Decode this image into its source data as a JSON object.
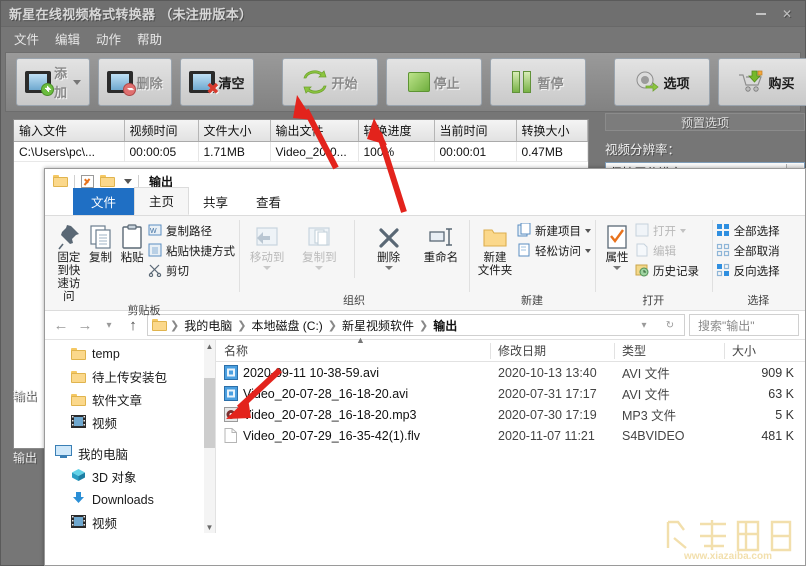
{
  "converter": {
    "title": "新星在线视频格式转换器 （未注册版本）",
    "window_buttons": [
      "minimize",
      "close"
    ],
    "menu": [
      "文件",
      "编辑",
      "动作",
      "帮助"
    ],
    "toolbar": [
      {
        "label": "添加",
        "icon": "film-add-icon",
        "has_dropdown": true,
        "disabled": true
      },
      {
        "label": "删除",
        "icon": "film-remove-icon",
        "has_dropdown": false,
        "disabled": true
      },
      {
        "label": "清空",
        "icon": "film-clear-icon",
        "has_dropdown": false,
        "disabled": false
      },
      {
        "label": "开始",
        "icon": "refresh-icon",
        "has_dropdown": false,
        "disabled": true
      },
      {
        "label": "停止",
        "icon": "stop-icon",
        "has_dropdown": false,
        "disabled": true
      },
      {
        "label": "暂停",
        "icon": "pause-icon",
        "has_dropdown": false,
        "disabled": true
      },
      {
        "label": "选项",
        "icon": "gear-icon",
        "has_dropdown": false,
        "disabled": false
      },
      {
        "label": "购买",
        "icon": "cart-icon",
        "has_dropdown": false,
        "disabled": false
      }
    ],
    "list": {
      "columns": [
        "输入文件",
        "视频时间",
        "文件大小",
        "输出文件",
        "转换进度",
        "当前时间",
        "转换大小"
      ],
      "rows": [
        {
          "input": "C:\\Users\\pc\\...",
          "duration": "00:00:05",
          "filesize": "1.71MB",
          "output": "Video_20-0...",
          "progress": "100%",
          "current_time": "00:00:01",
          "converted_size": "0.47MB"
        }
      ]
    },
    "right_panel": {
      "header": "预置选项",
      "resolution_label": "视频分辨率：",
      "resolution_value": "保持原分辨率"
    },
    "output_labels": [
      "输出",
      "输出"
    ]
  },
  "explorer": {
    "titlebar": {
      "folder_icon": "folder-icon",
      "properties_icon": "properties-icon",
      "new_folder_icon": "new-folder-icon",
      "dropdown_icon": "chevron-down-icon",
      "title": "输出"
    },
    "tabs": [
      {
        "label": "文件",
        "kind": "file"
      },
      {
        "label": "主页",
        "kind": "active"
      },
      {
        "label": "共享",
        "kind": "normal"
      },
      {
        "label": "查看",
        "kind": "normal"
      }
    ],
    "ribbon": {
      "groups": [
        {
          "name": "剪贴板",
          "big": [
            {
              "label": "固定到快\n速访问",
              "icon": "pin-icon",
              "disabled": false
            },
            {
              "label": "复制",
              "icon": "copy-icon",
              "disabled": false
            },
            {
              "label": "粘贴",
              "icon": "paste-icon",
              "disabled": false
            }
          ],
          "small": [
            {
              "label": "复制路径",
              "icon": "copy-path-icon"
            },
            {
              "label": "粘贴快捷方式",
              "icon": "paste-shortcut-icon"
            },
            {
              "label": "剪切",
              "icon": "scissors-icon"
            }
          ]
        },
        {
          "name": "组织",
          "big": [
            {
              "label": "移动到",
              "icon": "move-to-icon",
              "disabled": true
            },
            {
              "label": "复制到",
              "icon": "copy-to-icon",
              "disabled": true
            },
            {
              "label": "删除",
              "icon": "delete-x-icon",
              "disabled": false
            },
            {
              "label": "重命名",
              "icon": "rename-icon",
              "disabled": false
            }
          ]
        },
        {
          "name": "新建",
          "big": [
            {
              "label": "新建\n文件夹",
              "icon": "new-folder-icon",
              "disabled": false
            }
          ],
          "small": [
            {
              "label": "新建项目",
              "icon": "new-item-icon"
            },
            {
              "label": "轻松访问",
              "icon": "easy-access-icon"
            }
          ]
        },
        {
          "name": "打开",
          "big": [
            {
              "label": "属性",
              "icon": "properties-icon",
              "disabled": false
            }
          ],
          "small": [
            {
              "label": "打开",
              "icon": "open-icon",
              "disabled": true
            },
            {
              "label": "编辑",
              "icon": "edit-icon",
              "disabled": true
            },
            {
              "label": "历史记录",
              "icon": "history-icon",
              "disabled": false
            }
          ]
        },
        {
          "name": "选择",
          "small": [
            {
              "label": "全部选择",
              "icon": "select-all-icon"
            },
            {
              "label": "全部取消",
              "icon": "select-none-icon"
            },
            {
              "label": "反向选择",
              "icon": "invert-selection-icon"
            }
          ]
        }
      ]
    },
    "address": {
      "back_icon": "arrow-left-icon",
      "forward_icon": "arrow-right-icon",
      "recent_icon": "chevron-down-icon",
      "up_icon": "arrow-up-icon",
      "crumbs": [
        "我的电脑",
        "本地磁盘 (C:)",
        "新星视频软件",
        "输出"
      ],
      "dropdown_icon": "chevron-down-icon",
      "refresh_icon": "refresh-icon",
      "search_placeholder": "搜索\"输出\""
    },
    "nav_items": [
      {
        "label": "temp",
        "icon": "folder-icon",
        "level": 2
      },
      {
        "label": "待上传安装包",
        "icon": "folder-icon",
        "level": 2
      },
      {
        "label": "软件文章",
        "icon": "folder-icon",
        "level": 2
      },
      {
        "label": "视频",
        "icon": "video-folder-icon",
        "level": 2
      },
      {
        "label": "我的电脑",
        "icon": "this-pc-icon",
        "level": 1
      },
      {
        "label": "3D 对象",
        "icon": "3d-objects-icon",
        "level": 2
      },
      {
        "label": "Downloads",
        "icon": "downloads-icon",
        "level": 2
      },
      {
        "label": "视频",
        "icon": "video-folder-icon",
        "level": 2
      }
    ],
    "files": {
      "columns": [
        "名称",
        "修改日期",
        "类型",
        "大小"
      ],
      "sort_indicator": "caret-up-icon",
      "rows": [
        {
          "name": "2020-09-11 10-38-59.avi",
          "icon": "avi-file-icon",
          "date": "2020-10-13 13:40",
          "type": "AVI 文件",
          "size": "909 K"
        },
        {
          "name": "Video_20-07-28_16-18-20.avi",
          "icon": "avi-file-icon",
          "date": "2020-07-31 17:17",
          "type": "AVI 文件",
          "size": "63 K"
        },
        {
          "name": "Video_20-07-28_16-18-20.mp3",
          "icon": "mp3-file-icon",
          "date": "2020-07-30 17:19",
          "type": "MP3 文件",
          "size": "5 K"
        },
        {
          "name": "Video_20-07-29_16-35-42(1).flv",
          "icon": "generic-file-icon",
          "date": "2020-11-07 11:21",
          "type": "S4BVIDEO",
          "size": "481 K"
        }
      ]
    }
  },
  "annotations": {
    "arrows": [
      {
        "name": "arrow-to-start-button",
        "color": "#e3231c"
      },
      {
        "name": "arrow-to-progress",
        "color": "#e3231c"
      },
      {
        "name": "arrow-to-output-file",
        "color": "#e3231c"
      }
    ]
  },
  "watermark": {
    "text": "下载吧",
    "url": "www.xiazaiba.com",
    "color": "#e8c56a"
  }
}
